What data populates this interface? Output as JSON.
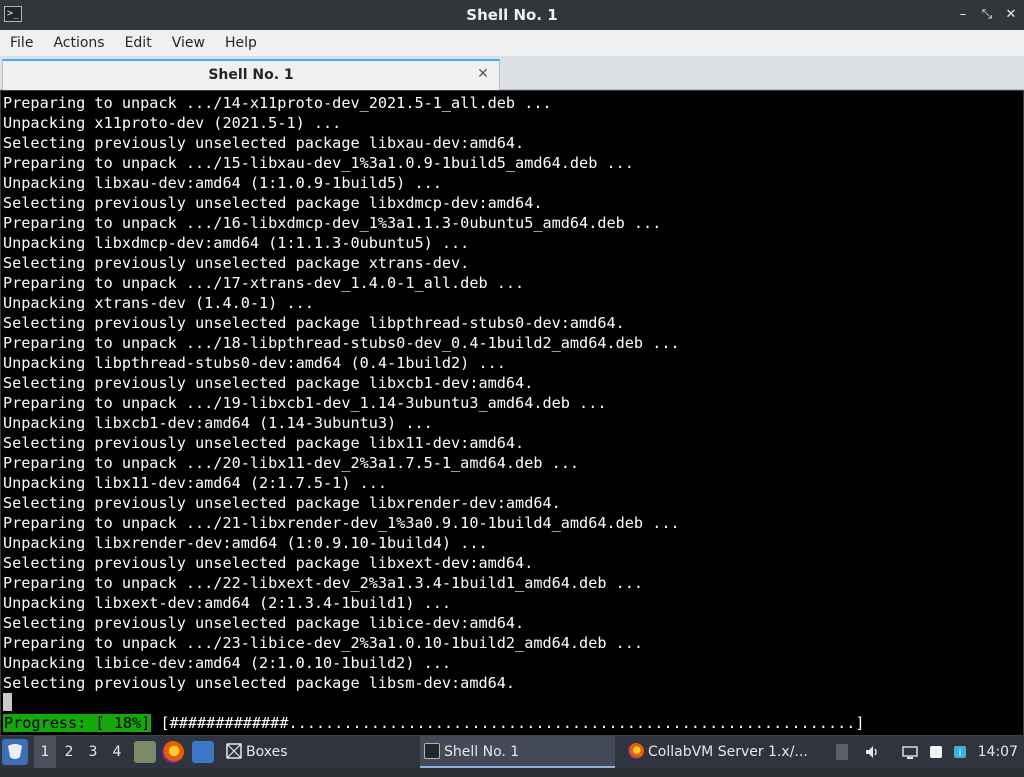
{
  "window": {
    "title": "Shell No. 1",
    "controls": [
      "–",
      "⤡",
      "✕"
    ]
  },
  "menu": [
    "File",
    "Actions",
    "Edit",
    "View",
    "Help"
  ],
  "tab": {
    "label": "Shell No. 1",
    "close": "✕"
  },
  "terminal": {
    "lines": [
      "Preparing to unpack .../14-x11proto-dev_2021.5-1_all.deb ...",
      "Unpacking x11proto-dev (2021.5-1) ...",
      "Selecting previously unselected package libxau-dev:amd64.",
      "Preparing to unpack .../15-libxau-dev_1%3a1.0.9-1build5_amd64.deb ...",
      "Unpacking libxau-dev:amd64 (1:1.0.9-1build5) ...",
      "Selecting previously unselected package libxdmcp-dev:amd64.",
      "Preparing to unpack .../16-libxdmcp-dev_1%3a1.1.3-0ubuntu5_amd64.deb ...",
      "Unpacking libxdmcp-dev:amd64 (1:1.1.3-0ubuntu5) ...",
      "Selecting previously unselected package xtrans-dev.",
      "Preparing to unpack .../17-xtrans-dev_1.4.0-1_all.deb ...",
      "Unpacking xtrans-dev (1.4.0-1) ...",
      "Selecting previously unselected package libpthread-stubs0-dev:amd64.",
      "Preparing to unpack .../18-libpthread-stubs0-dev_0.4-1build2_amd64.deb ...",
      "Unpacking libpthread-stubs0-dev:amd64 (0.4-1build2) ...",
      "Selecting previously unselected package libxcb1-dev:amd64.",
      "Preparing to unpack .../19-libxcb1-dev_1.14-3ubuntu3_amd64.deb ...",
      "Unpacking libxcb1-dev:amd64 (1.14-3ubuntu3) ...",
      "Selecting previously unselected package libx11-dev:amd64.",
      "Preparing to unpack .../20-libx11-dev_2%3a1.7.5-1_amd64.deb ...",
      "Unpacking libx11-dev:amd64 (2:1.7.5-1) ...",
      "Selecting previously unselected package libxrender-dev:amd64.",
      "Preparing to unpack .../21-libxrender-dev_1%3a0.9.10-1build4_amd64.deb ...",
      "Unpacking libxrender-dev:amd64 (1:0.9.10-1build4) ...",
      "Selecting previously unselected package libxext-dev:amd64.",
      "Preparing to unpack .../22-libxext-dev_2%3a1.3.4-1build1_amd64.deb ...",
      "Unpacking libxext-dev:amd64 (2:1.3.4-1build1) ...",
      "Selecting previously unselected package libice-dev:amd64.",
      "Preparing to unpack .../23-libice-dev_2%3a1.0.10-1build2_amd64.deb ...",
      "Unpacking libice-dev:amd64 (2:1.0.10-1build2) ...",
      "Selecting previously unselected package libsm-dev:amd64."
    ],
    "progress_label": "Progress: [ 18%]",
    "progress_bar": " [#############..............................................................]",
    "progress_percent": 18
  },
  "taskbar": {
    "desktops": [
      "1",
      "2",
      "3",
      "4"
    ],
    "active_desktop": "1",
    "tasks": [
      {
        "label": "Boxes",
        "icon": "boxes-icon"
      },
      {
        "label": "Shell No. 1",
        "icon": "terminal-icon"
      },
      {
        "label": "CollabVM Server 1.x/...",
        "icon": "firefox-icon"
      }
    ],
    "clock": "14:07"
  }
}
